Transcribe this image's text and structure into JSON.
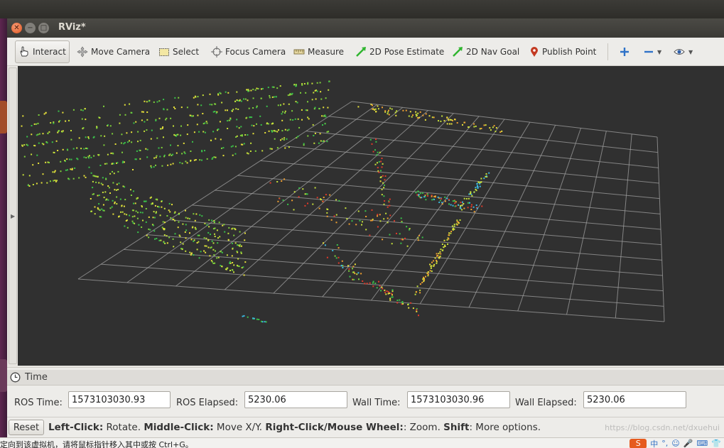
{
  "window": {
    "title": "RViz*"
  },
  "toolbar": {
    "tools": [
      {
        "label": "Interact",
        "icon": "hand-pointer-icon",
        "active": true
      },
      {
        "label": "Move Camera",
        "icon": "move-arrows-icon"
      },
      {
        "label": "Select",
        "icon": "select-rectangle-icon"
      },
      {
        "label": "Focus Camera",
        "icon": "focus-crosshair-icon"
      },
      {
        "label": "Measure",
        "icon": "ruler-icon"
      },
      {
        "label": "2D Pose Estimate",
        "icon": "green-arrow-icon"
      },
      {
        "label": "2D Nav Goal",
        "icon": "green-arrow-icon"
      },
      {
        "label": "Publish Point",
        "icon": "map-pin-icon"
      }
    ],
    "extra_icons": [
      "plus-icon",
      "minus-icon",
      "eye-icon"
    ]
  },
  "time_panel": {
    "title": "Time",
    "ros_time_label": "ROS Time:",
    "ros_time_value": "1573103030.93",
    "ros_elapsed_label": "ROS Elapsed:",
    "ros_elapsed_value": "5230.06",
    "wall_time_label": "Wall Time:",
    "wall_time_value": "1573103030.96",
    "wall_elapsed_label": "Wall Elapsed:",
    "wall_elapsed_value": "5230.06"
  },
  "status_bar": {
    "reset_label": "Reset",
    "hint": [
      {
        "bold": "Left-Click:",
        "text": " Rotate. "
      },
      {
        "bold": "Middle-Click:",
        "text": " Move X/Y. "
      },
      {
        "bold": "Right-Click/Mouse Wheel:",
        "text": ": Zoom. "
      },
      {
        "bold": "Shift",
        "text": ": More options."
      }
    ],
    "watermark": "https://blog.csdn.net/dxuehui"
  },
  "notification": {
    "text": "定向到该虚拟机，请将鼠标指针移入其中或按 Ctrl+G。",
    "ime_chars": [
      "中",
      "°,",
      "☺",
      "🎤",
      "⌨",
      "👕"
    ]
  },
  "colors": {
    "viewport_bg": "#303030",
    "grid_line": "#a0a0a0",
    "accent_close": "#e3561f"
  }
}
